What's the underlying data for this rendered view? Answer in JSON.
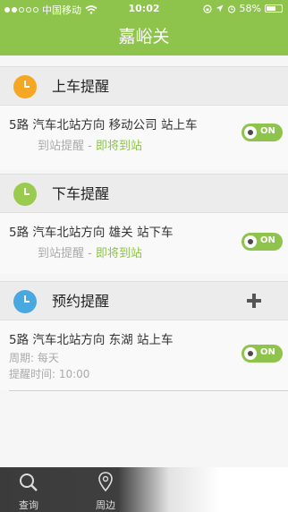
{
  "status_bar": {
    "carrier": "中国移动",
    "time": "10:02",
    "battery": "58%"
  },
  "nav": {
    "title": "嘉峪关"
  },
  "sections": [
    {
      "title": "上车提醒",
      "icon_color": "#f5a623",
      "item": {
        "line1": "5路  汽车北站方向    移动公司 站上车",
        "line2_prefix": "到站提醒 - ",
        "line2_accent": "即将到站",
        "toggle": "ON"
      }
    },
    {
      "title": "下车提醒",
      "icon_color": "#9acb4f",
      "item": {
        "line1": "5路  汽车北站方向    雄关 站下车",
        "line2_prefix": "到站提醒 - ",
        "line2_accent": "即将到站",
        "toggle": "ON"
      }
    },
    {
      "title": "预约提醒",
      "icon_color": "#4aa8e0",
      "item": {
        "line1": "5路  汽车北站方向    东湖 站上车",
        "period": "周期: 每天",
        "remind_time": "提醒时间: 10:00",
        "toggle": "ON"
      }
    }
  ],
  "tab_bar": {
    "items": [
      {
        "label": "查询",
        "icon": "search-icon"
      },
      {
        "label": "周边",
        "icon": "location-pin-icon"
      }
    ]
  },
  "colors": {
    "accent": "#8ec34c"
  }
}
